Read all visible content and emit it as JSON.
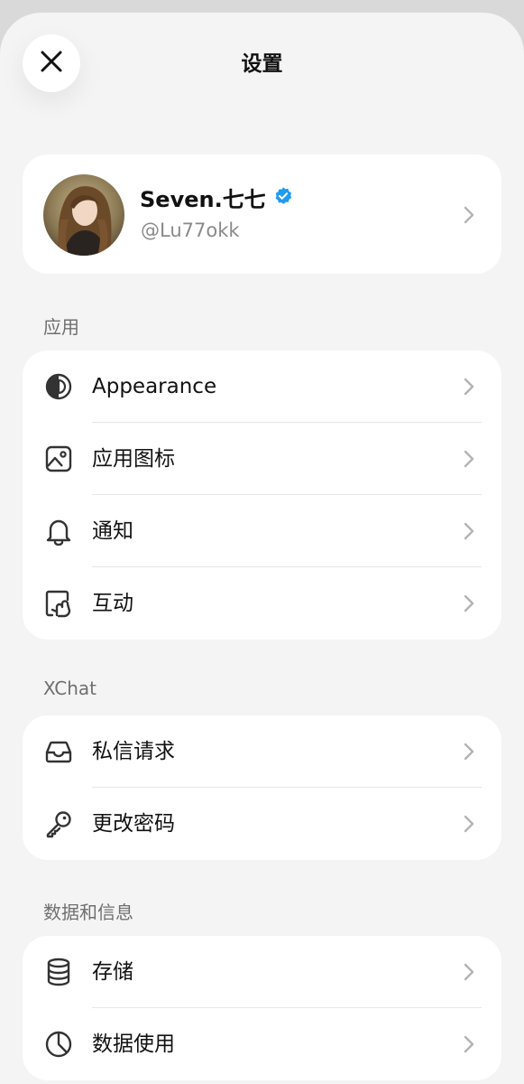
{
  "header": {
    "title": "设置"
  },
  "profile": {
    "name": "Seven.七七",
    "handle": "@Lu77okk",
    "verified_color": "#1d9bf0"
  },
  "sections": {
    "app": {
      "label": "应用",
      "items": [
        {
          "label": "Appearance",
          "icon": "appearance-icon"
        },
        {
          "label": "应用图标",
          "icon": "app-icon-icon"
        },
        {
          "label": "通知",
          "icon": "bell-icon"
        },
        {
          "label": "互动",
          "icon": "interaction-icon"
        }
      ]
    },
    "xchat": {
      "label": "XChat",
      "items": [
        {
          "label": "私信请求",
          "icon": "inbox-icon"
        },
        {
          "label": "更改密码",
          "icon": "key-icon"
        }
      ]
    },
    "data": {
      "label": "数据和信息",
      "items": [
        {
          "label": "存储",
          "icon": "database-icon"
        },
        {
          "label": "数据使用",
          "icon": "clock-icon"
        }
      ]
    }
  },
  "colors": {
    "background": "#f4f4f4",
    "card": "#ffffff",
    "text": "#111111",
    "secondary_text": "#8a8a8a",
    "chevron": "#b3b3b3"
  }
}
